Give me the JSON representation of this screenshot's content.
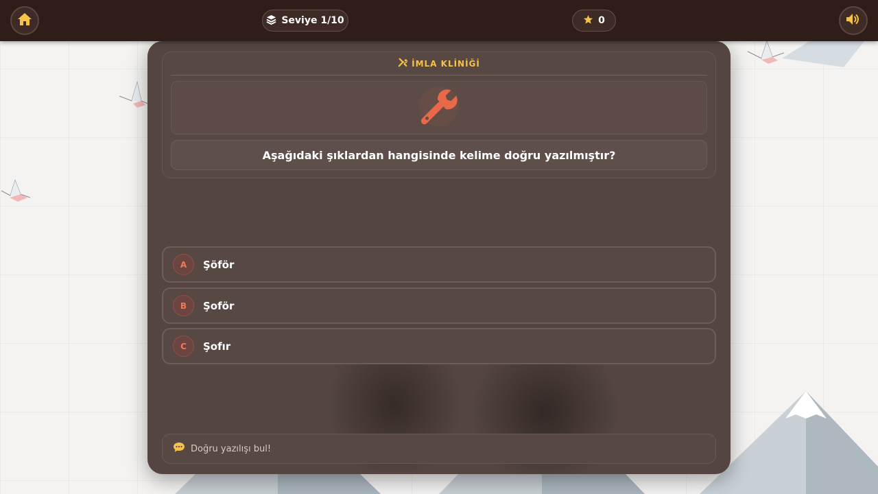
{
  "topbar": {
    "level_label": "Seviye 1/10",
    "score": "0",
    "icons": {
      "home": "home-icon",
      "level": "layers-icon",
      "score": "star-icon",
      "sound": "volume-icon"
    }
  },
  "quiz": {
    "category": "İMLA KLİNİĞİ",
    "category_icon": "tools-icon",
    "main_icon": "wrench-icon",
    "question": "Aşağıdaki şıklardan hangisinde kelime doğru yazılmıştır?",
    "options": [
      {
        "letter": "A",
        "text": "Şöför"
      },
      {
        "letter": "B",
        "text": "Şoför"
      },
      {
        "letter": "C",
        "text": "Şofır"
      }
    ],
    "hint": "Doğru yazılışı bul!",
    "hint_icon": "speech-bubble-icon"
  },
  "colors": {
    "accent_gold": "#f5c24a",
    "accent_orange": "#e8694a",
    "topbar_bg": "#2e1d18",
    "card_bg": "#544541"
  }
}
